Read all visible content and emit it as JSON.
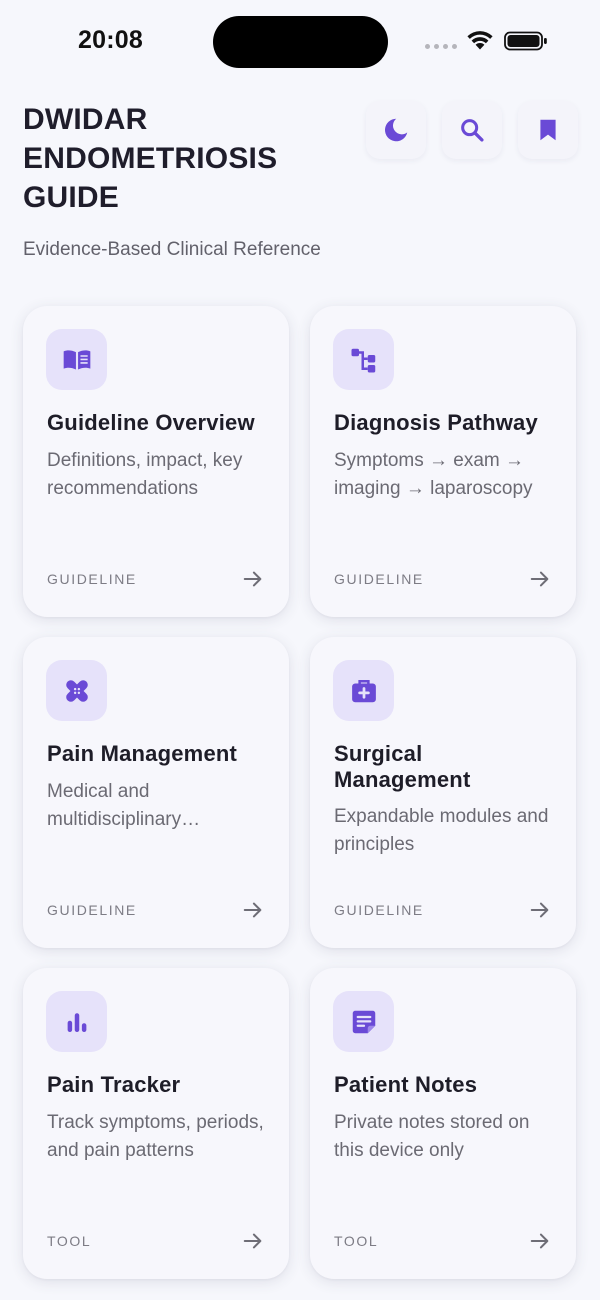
{
  "status_bar": {
    "time": "20:08"
  },
  "header": {
    "title": "DWIDAR ENDOMETRIOSIS GUIDE",
    "subtitle": "Evidence-Based Clinical Reference",
    "actions": [
      {
        "icon": "moon-icon"
      },
      {
        "icon": "search-icon"
      },
      {
        "icon": "bookmark-icon"
      }
    ]
  },
  "colors": {
    "accent": "#6a4ad6",
    "icon_bg": "#e6e2fa",
    "background": "#f6f7fc"
  },
  "cards": [
    {
      "title": "Guideline Overview",
      "description": "Definitions, impact, key recommendations",
      "tag": "GUIDELINE",
      "icon": "book-icon"
    },
    {
      "title": "Diagnosis Pathway",
      "description": "Symptoms → exam → imaging → laparoscopy",
      "tag": "GUIDELINE",
      "icon": "flowchart-icon"
    },
    {
      "title": "Pain Management",
      "description": "Medical and multidisciplinary approaches",
      "tag": "GUIDELINE",
      "icon": "bandage-icon"
    },
    {
      "title": "Surgical Management",
      "description": "Expandable modules and principles",
      "tag": "GUIDELINE",
      "icon": "medical-kit-icon"
    },
    {
      "title": "Pain Tracker",
      "description": "Track symptoms, periods, and pain patterns",
      "tag": "TOOL",
      "icon": "bar-chart-icon"
    },
    {
      "title": "Patient Notes",
      "description": "Private notes stored on this device only",
      "tag": "TOOL",
      "icon": "note-icon"
    }
  ]
}
